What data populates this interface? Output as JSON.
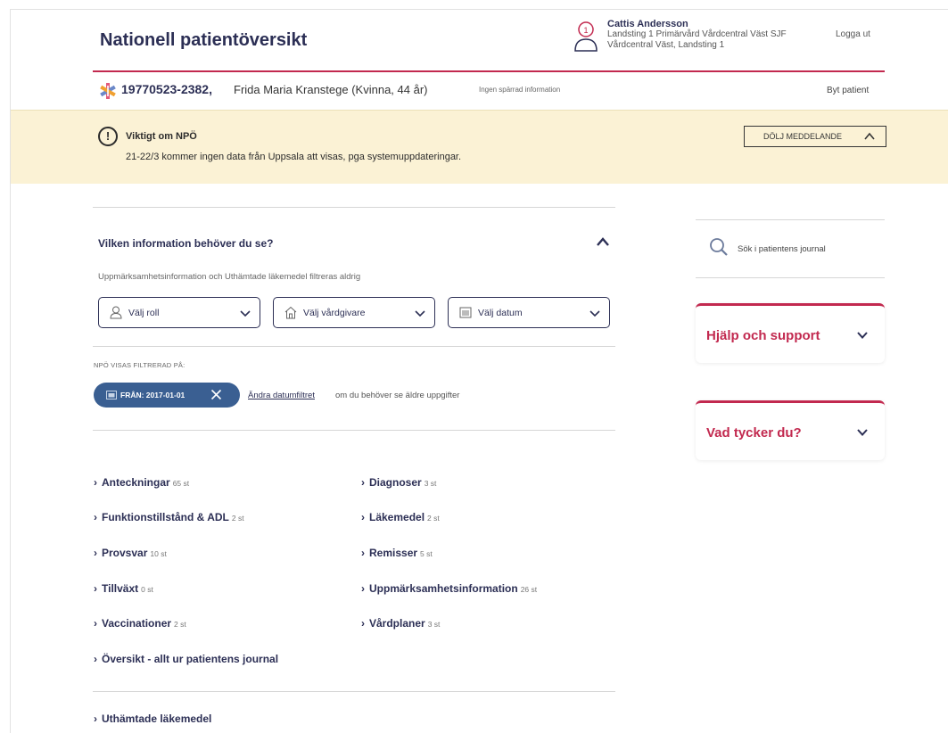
{
  "header": {
    "app_title": "Nationell patientöversikt",
    "user_name": "Cattis Andersson",
    "user_org_line1": "Landsting 1 Primärvård Vårdcentral Väst SJF",
    "user_org_line2": "Vårdcentral Väst, Landsting 1",
    "logout": "Logga ut"
  },
  "patient": {
    "id": "19770523-2382,",
    "name": "Frida Maria Kranstege (Kvinna, 44 år)",
    "blocked_info": "Ingen spärrad information",
    "change_patient": "Byt patient"
  },
  "notice": {
    "icon": "!",
    "title": "Viktigt om NPÖ",
    "text": "21-22/3 kommer ingen data från Uppsala att visas, pga systemuppdateringar.",
    "hide_button": "DÖLJ MEDDELANDE"
  },
  "filter": {
    "question": "Vilken information behöver du se?",
    "note": "Uppmärksamhetsinformation och Uthämtade läkemedel filtreras aldrig",
    "selects": [
      {
        "label": "Välj roll",
        "icon": "person-icon"
      },
      {
        "label": "Välj vårdgivare",
        "icon": "house-icon"
      },
      {
        "label": "Välj datum",
        "icon": "calendar-icon"
      }
    ],
    "filtered_heading": "NPÖ VISAS FILTRERAD PÅ:",
    "chip_label": "FRÅN: 2017-01-01",
    "change_link": "Ändra datumfiltret",
    "change_rest": "om du behöver se äldre uppgifter"
  },
  "categories": [
    {
      "label": "Anteckningar",
      "count": "65 st"
    },
    {
      "label": "Diagnoser",
      "count": "3 st"
    },
    {
      "label": "Funktionstillstånd & ADL",
      "count": "2 st"
    },
    {
      "label": "Läkemedel",
      "count": "2 st"
    },
    {
      "label": "Provsvar",
      "count": "10 st"
    },
    {
      "label": "Remisser",
      "count": "5 st"
    },
    {
      "label": "Tillväxt",
      "count": "0 st"
    },
    {
      "label": "Uppmärksamhetsinformation",
      "count": "26 st"
    },
    {
      "label": "Vaccinationer",
      "count": "2 st"
    },
    {
      "label": "Vårdplaner",
      "count": "3 st"
    },
    {
      "label": "Översikt - allt ur patientens journal",
      "count": ""
    },
    {
      "label": "Uthämtade läkemedel",
      "count": ""
    }
  ],
  "sidebar": {
    "search": "Sök i patientens journal",
    "help": "Hjälp och support",
    "feedback": "Vad tycker du?"
  },
  "colors": {
    "brand_navy": "#2c2f55",
    "accent_red": "#c2294f",
    "notice_bg": "#fbf2d5",
    "chip_blue": "#3a5f92"
  }
}
